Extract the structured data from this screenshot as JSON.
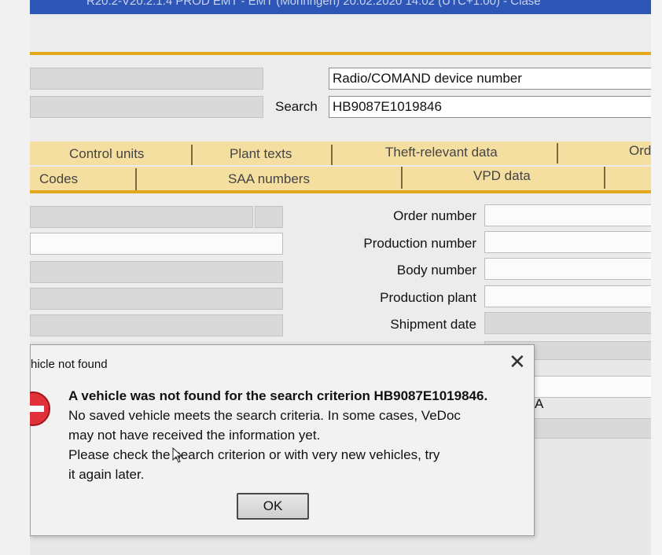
{
  "window": {
    "title": "R20.2-V20.2.1.4 PROD EMT - EMT (Möhringen) 20.02.2020 14:02 (UTC+1:00) - Clase"
  },
  "search": {
    "type_value": "Radio/COMAND device number",
    "label": "Search",
    "value": "HB9087E1019846"
  },
  "tabs": {
    "row1": [
      "Control units",
      "Plant texts",
      "Theft-relevant data",
      "Ord"
    ],
    "row2": [
      "Codes",
      "SAA numbers",
      "VPD data"
    ]
  },
  "vehicle_fields": {
    "order_number": "Order number",
    "production_number": "Production number",
    "body_number": "Body number",
    "production_plant": "Production plant",
    "shipment_date": "Shipment date"
  },
  "partial_text": "A",
  "dialog": {
    "title": "hicle not found",
    "close_glyph": "✕",
    "icon": "stop-icon",
    "message_bold": "A vehicle was not found for the search criterion HB9087E1019846.",
    "message_lines": [
      "No saved vehicle meets the search criteria. In some cases, VeDoc",
      "may not have received the information yet.",
      "Please check the search criterion or with very new vehicles, try",
      "it again later."
    ],
    "ok_label": "OK"
  },
  "colors": {
    "title_bar": "#2e56b6",
    "gold": "#e3a81c",
    "tab_background": "#f5dfa0",
    "error_red": "#e0313a"
  }
}
